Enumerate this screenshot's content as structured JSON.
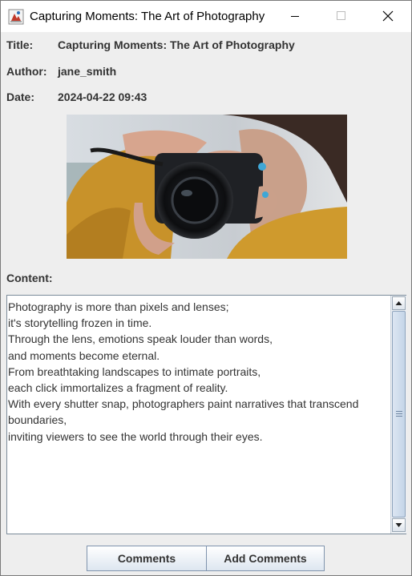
{
  "window": {
    "title": "Capturing Moments: The Art of Photography"
  },
  "fields": {
    "title_label": "Title:",
    "title_value": "Capturing Moments: The Art of Photography",
    "author_label": "Author:",
    "author_value": "jane_smith",
    "date_label": "Date:",
    "date_value": "2024-04-22 09:43"
  },
  "content": {
    "label": "Content:",
    "lines": [
      "Photography is more than pixels and lenses;",
      "it's storytelling frozen in time.",
      "Through the lens, emotions speak louder than words,",
      "and moments become eternal.",
      "From breathtaking landscapes to intimate portraits,",
      "each click immortalizes a fragment of reality.",
      "With every shutter snap, photographers paint narratives that transcend",
      "boundaries,",
      "inviting viewers to see the world through their eyes."
    ]
  },
  "buttons": {
    "comments": "Comments",
    "add_comments": "Add Comments"
  },
  "image": {
    "description_icon": "photographer-image"
  }
}
